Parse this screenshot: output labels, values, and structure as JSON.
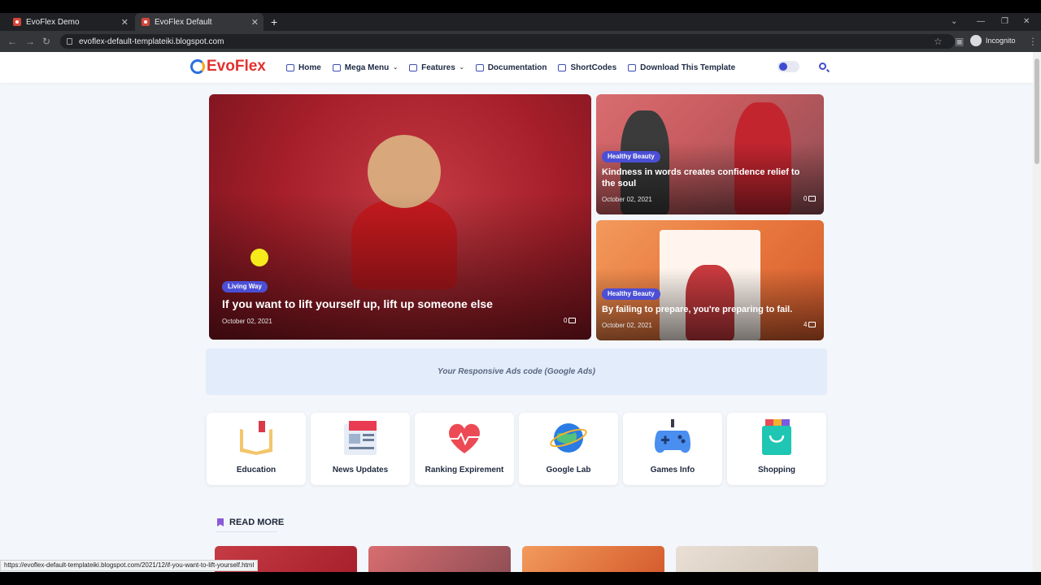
{
  "browser": {
    "tabs": [
      {
        "title": "EvoFlex Demo",
        "active": false
      },
      {
        "title": "EvoFlex Default",
        "active": true
      }
    ],
    "url": "evoflex-default-templateiki.blogspot.com",
    "profile_label": "Incognito",
    "status_url": "https://evoflex-default-templateiki.blogspot.com/2021/12/if-you-want-to-lift-yourself.html"
  },
  "header": {
    "logo_text": "EvoFlex",
    "menu": [
      {
        "label": "Home",
        "icon": "home-icon",
        "has_dropdown": false
      },
      {
        "label": "Mega Menu",
        "icon": "folder-open-icon",
        "has_dropdown": true
      },
      {
        "label": "Features",
        "icon": "layers-icon",
        "has_dropdown": true
      },
      {
        "label": "Documentation",
        "icon": "folder-icon",
        "has_dropdown": false
      },
      {
        "label": "ShortCodes",
        "icon": "code-icon",
        "has_dropdown": false
      },
      {
        "label": "Download This Template",
        "icon": "branch-icon",
        "has_dropdown": false
      }
    ]
  },
  "featured": {
    "big": {
      "tag": "Living Way",
      "title": "If you want to lift yourself up, lift up someone else",
      "date": "October 02, 2021",
      "comments": "0"
    },
    "side": [
      {
        "tag": "Healthy Beauty",
        "title": "Kindness in words creates confidence relief to the soul",
        "date": "October 02, 2021",
        "comments": "0"
      },
      {
        "tag": "Healthy Beauty",
        "title": "By failing to prepare, you're preparing to fail.",
        "date": "October 02, 2021",
        "comments": "4"
      }
    ]
  },
  "ads_text": "Your Responsive Ads code (Google Ads)",
  "categories": [
    {
      "label": "Education",
      "icon": "book-icon"
    },
    {
      "label": "News Updates",
      "icon": "newspaper-icon"
    },
    {
      "label": "Ranking Expirement",
      "icon": "heart-pulse-icon"
    },
    {
      "label": "Google Lab",
      "icon": "globe-icon"
    },
    {
      "label": "Games Info",
      "icon": "gamepad-icon"
    },
    {
      "label": "Shopping",
      "icon": "shopping-bag-icon"
    }
  ],
  "read_more": "READ MORE",
  "colors": {
    "accent": "#4b4fd6",
    "logo": "#e2322e"
  }
}
